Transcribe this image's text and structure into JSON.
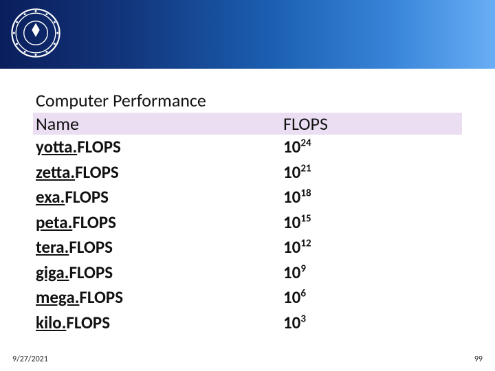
{
  "header": {
    "logo_alt": "university-seal"
  },
  "content": {
    "title": "Computer Performance",
    "col_name": "Name",
    "col_flops": "FLOPS",
    "rows": [
      {
        "prefix": "yotta.",
        "suffix": "FLOPS",
        "base": "10",
        "exp": "24"
      },
      {
        "prefix": "zetta.",
        "suffix": "FLOPS",
        "base": "10",
        "exp": "21"
      },
      {
        "prefix": "exa.",
        "suffix": "FLOPS",
        "base": "10",
        "exp": "18"
      },
      {
        "prefix": "peta.",
        "suffix": "FLOPS",
        "base": "10",
        "exp": "15"
      },
      {
        "prefix": "tera.",
        "suffix": "FLOPS",
        "base": "10",
        "exp": "12"
      },
      {
        "prefix": "giga.",
        "suffix": "FLOPS",
        "base": "10",
        "exp": "9"
      },
      {
        "prefix": "mega.",
        "suffix": "FLOPS",
        "base": "10",
        "exp": "6"
      },
      {
        "prefix": "kilo.",
        "suffix": "FLOPS",
        "base": "10",
        "exp": "3"
      }
    ]
  },
  "footer": {
    "date": "9/27/2021",
    "page": "99"
  },
  "chart_data": {
    "type": "table",
    "title": "Computer Performance",
    "columns": [
      "Name",
      "FLOPS"
    ],
    "rows": [
      [
        "yotta.FLOPS",
        "10^24"
      ],
      [
        "zetta.FLOPS",
        "10^21"
      ],
      [
        "exa.FLOPS",
        "10^18"
      ],
      [
        "peta.FLOPS",
        "10^15"
      ],
      [
        "tera.FLOPS",
        "10^12"
      ],
      [
        "giga.FLOPS",
        "10^9"
      ],
      [
        "mega.FLOPS",
        "10^6"
      ],
      [
        "kilo.FLOPS",
        "10^3"
      ]
    ]
  }
}
